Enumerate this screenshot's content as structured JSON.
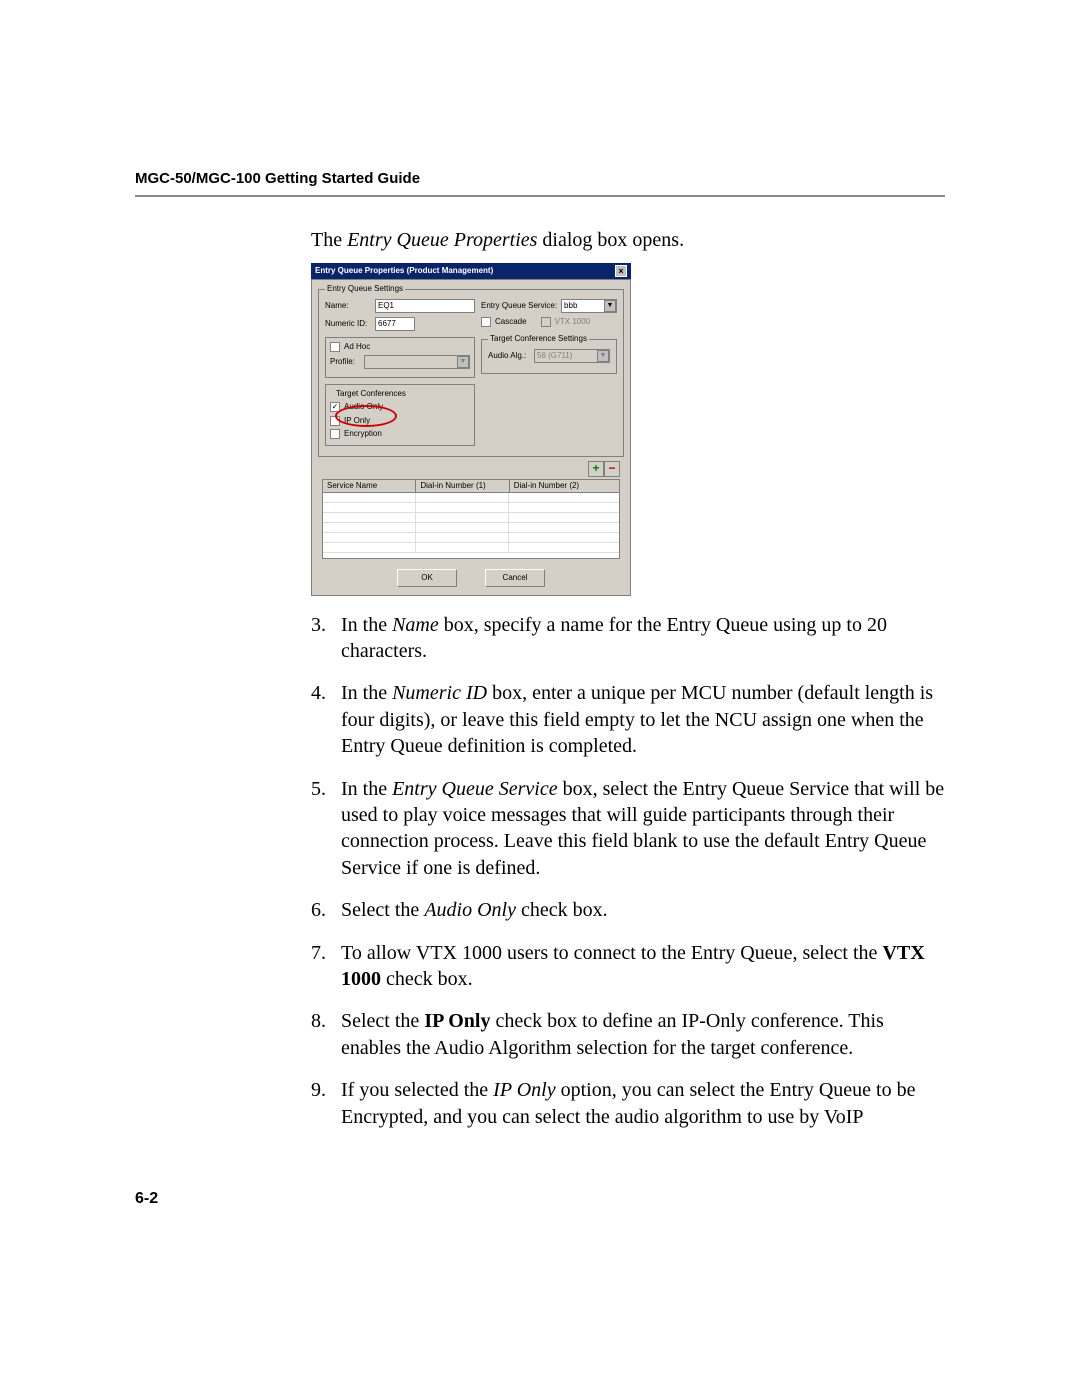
{
  "header": "MGC-50/MGC-100 Getting Started Guide",
  "intro_pre": "The ",
  "intro_em": "Entry Queue Properties",
  "intro_post": " dialog box opens.",
  "dialog": {
    "title": "Entry Queue Properties (Product Management)",
    "eq_settings_legend": "Entry Queue Settings",
    "name_label": "Name:",
    "name_value": "EQ1",
    "numeric_label": "Numeric ID:",
    "numeric_value": "6677",
    "adhoc_label": "Ad Hoc",
    "profile_label": "Profile:",
    "eq_service_label": "Entry Queue Service:",
    "eq_service_value": "bbb",
    "cascade_label": "Cascade",
    "vtx_label": "VTX 1000",
    "tcs_legend": "Target Conference Settings",
    "audio_alg_label": "Audio Alg.:",
    "audio_alg_value": "56 (G711)",
    "tc_legend": "Target Conferences",
    "audio_only_label": "Audio Only",
    "ip_only_label": "IP Only",
    "encryption_label": "Encryption",
    "col1": "Service Name",
    "col2": "Dial-in Number (1)",
    "col3": "Dial-in Number (2)",
    "ok": "OK",
    "cancel": "Cancel"
  },
  "steps": {
    "s3_num": "3.",
    "s3a": "In the ",
    "s3b": "Name",
    "s3c": " box, specify a name for the Entry Queue using up to 20 characters.",
    "s4_num": "4.",
    "s4a": "In the ",
    "s4b": "Numeric ID",
    "s4c": " box, enter a unique per MCU number (default length is four digits), or leave this field empty to let the NCU assign one when the Entry Queue definition is completed.",
    "s5_num": "5.",
    "s5a": "In the ",
    "s5b": "Entry Queue Service",
    "s5c": " box, select the Entry Queue Service that will be used to play voice messages that will guide participants through their connection process. Leave this field blank to use the default Entry Queue Service if one is defined.",
    "s6_num": "6.",
    "s6a": "Select the ",
    "s6b": "Audio Only",
    "s6c": " check box.",
    "s7_num": "7.",
    "s7a": "To allow VTX 1000 users to connect to the Entry Queue, select the ",
    "s7b": "VTX 1000",
    "s7c": " check box.",
    "s8_num": "8.",
    "s8a": "Select the ",
    "s8b": "IP Only",
    "s8c": " check box to define an IP-Only conference. This enables the Audio Algorithm selection for the target conference.",
    "s9_num": "9.",
    "s9a": "If you selected the ",
    "s9b": "IP Only",
    "s9c": " option, you can select the Entry Queue to be Encrypted, and you can select the audio algorithm to use by VoIP"
  },
  "page_num": "6-2"
}
